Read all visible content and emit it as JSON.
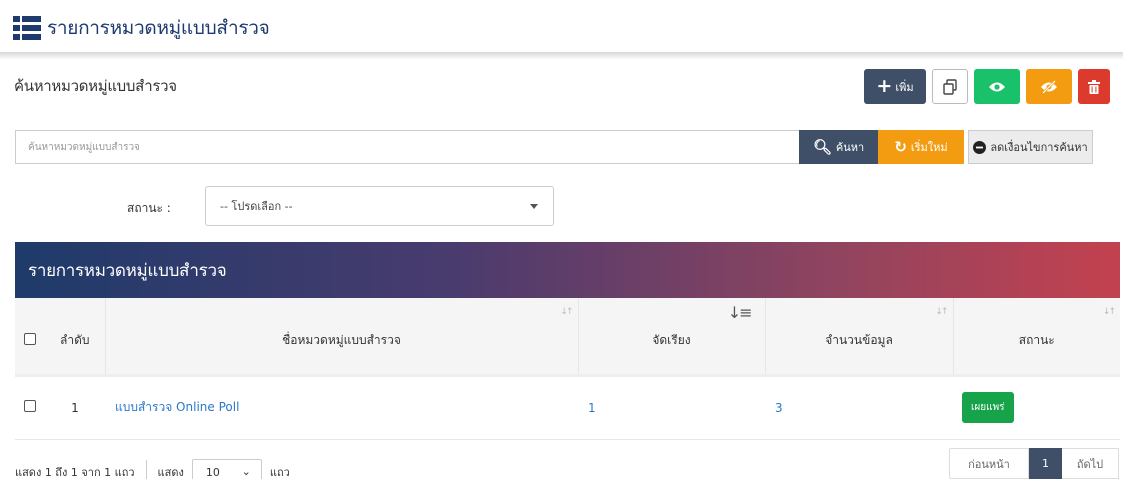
{
  "page": {
    "title": "รายการหมวดหมู่แบบสำรวจ",
    "icon": "list-icon"
  },
  "search_section": {
    "title": "ค้นหาหมวดหมู่แบบสำรวจ",
    "placeholder": "ค้นหาหมวดหมู่แบบสำรวจ",
    "value": "",
    "search_label": "ค้นหา",
    "reset_label": "เริ่มใหม่",
    "unfilter_label": "ลดเงื่อนไขการค้นหา"
  },
  "toolbar": {
    "add_label": "เพิ่ม"
  },
  "filter": {
    "status_label": "สถานะ :",
    "status_value": "-- โปรดเลือก --"
  },
  "panel": {
    "title": "รายการหมวดหมู่แบบสำรวจ"
  },
  "table": {
    "headers": {
      "order": "ลำดับ",
      "name": "ชื่อหมวดหมู่แบบสำรวจ",
      "sort": "จัดเรียง",
      "count": "จำนวนข้อมูล",
      "status": "สถานะ"
    },
    "rows": [
      {
        "order": "1",
        "name": "แบบสำรวจ Online Poll",
        "sort": "1",
        "count": "3",
        "status": "เผยแพร่"
      }
    ]
  },
  "footer": {
    "info": "แสดง 1 ถึง 1 จาก 1 แถว",
    "show_label": "แสดง",
    "page_length": "10",
    "rows_label": "แถว",
    "prev": "ก่อนหน้า",
    "current_page": "1",
    "next": "ถัดไป"
  },
  "colors": {
    "primary": "#3f4f68",
    "warning": "#f39c12",
    "success": "#19c26a",
    "danger": "#dd3a2e",
    "link": "#2c79c8"
  }
}
